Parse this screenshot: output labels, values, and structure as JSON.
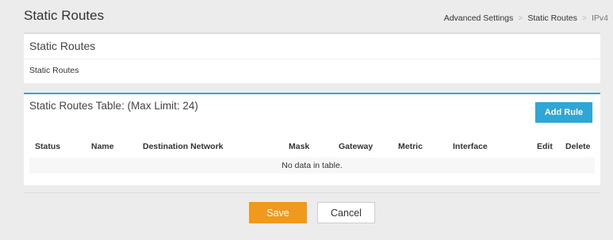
{
  "header": {
    "title": "Static Routes",
    "breadcrumb": [
      "Advanced Settings",
      "Static Routes",
      "IPv4"
    ],
    "separator": ">"
  },
  "panel_routes": {
    "title": "Static Routes",
    "label": "Static Routes"
  },
  "panel_table": {
    "title": "Static Routes Table: (Max Limit: 24)",
    "add_label": "Add Rule",
    "columns": [
      "Status",
      "Name",
      "Destination Network",
      "Mask",
      "Gateway",
      "Metric",
      "Interface",
      "Edit",
      "Delete"
    ],
    "empty_text": "No data in table."
  },
  "footer": {
    "save_label": "Save",
    "cancel_label": "Cancel"
  },
  "colors": {
    "accent": "#2ea6d6",
    "save": "#ef9a1f",
    "background": "#ececec"
  }
}
